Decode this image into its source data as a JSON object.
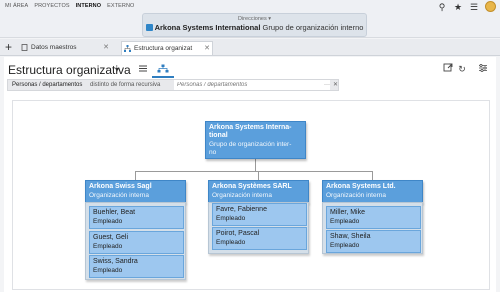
{
  "topnav": [
    "MI ÁREA",
    "PROYECTOS",
    "INTERNO",
    "EXTERNO"
  ],
  "topnav_active": "INTERNO",
  "context": {
    "label": "Direcciones",
    "company": "Arkona Systems International",
    "type": "Grupo de organización interno"
  },
  "tabs": [
    {
      "label": "Datos maestros"
    },
    {
      "label": "Estructura organizat"
    }
  ],
  "page": {
    "title": "Estructura organizativa"
  },
  "filter": {
    "label": "Personas / departamentos",
    "mode": "distinto de forma recursiva",
    "placeholder": "Personas / departamentos",
    "dots": "···",
    "clear": "✕"
  },
  "org": {
    "root": {
      "title_line1": "Arkona Systems Interna-",
      "title_line2": "tional",
      "sub_line1": "Grupo de organización inter-",
      "sub_line2": "no"
    },
    "children": [
      {
        "title": "Arkona Swiss Sagl",
        "sub": "Organización interna",
        "members": [
          {
            "name": "Buehler, Beat",
            "role": "Empleado"
          },
          {
            "name": "Guest, Geli",
            "role": "Empleado"
          },
          {
            "name": "Swiss, Sandra",
            "role": "Empleado"
          }
        ]
      },
      {
        "title": "Arkona Systèmes SARL",
        "sub": "Organización interna",
        "members": [
          {
            "name": "Favre, Fabienne",
            "role": "Empleado"
          },
          {
            "name": "Poirot, Pascal",
            "role": "Empleado"
          }
        ]
      },
      {
        "title": "Arkona Systems Ltd.",
        "sub": "Organización interna",
        "members": [
          {
            "name": "Miller, Mike",
            "role": "Empleado"
          },
          {
            "name": "Shaw, Sheila",
            "role": "Empleado"
          }
        ]
      }
    ]
  },
  "colors": {
    "node": "#5b9fdc",
    "member": "#9dc7ef",
    "accent": "#2f7ec0"
  }
}
